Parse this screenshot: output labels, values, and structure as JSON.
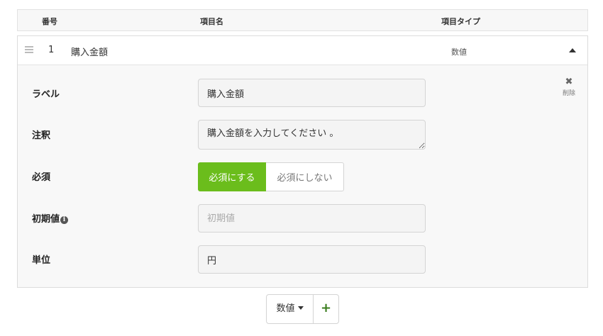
{
  "table_header": {
    "number": "番号",
    "name": "項目名",
    "type": "項目タイプ"
  },
  "item": {
    "number": "1",
    "name": "購入金額",
    "type": "数値"
  },
  "fields": {
    "label": {
      "title": "ラベル",
      "value": "購入金額"
    },
    "note": {
      "title": "注釈",
      "value": "購入金額を入力してください 。"
    },
    "required": {
      "title": "必須",
      "on_label": "必須にする",
      "off_label": "必須にしない"
    },
    "initial_value": {
      "title": "初期値",
      "placeholder": "初期値",
      "value": ""
    },
    "unit": {
      "title": "単位",
      "value": "円"
    }
  },
  "delete_label": "削除",
  "add_control": {
    "type_label": "数値",
    "add_label": "+"
  },
  "icons": {
    "drag": "drag-handle-icon",
    "collapse": "caret-up-icon",
    "delete": "close-icon",
    "info": "info-icon",
    "dropdown": "caret-down-icon",
    "add": "plus-icon"
  },
  "colors": {
    "accent_green": "#6bbd1c",
    "plus_green": "#3a7d1d"
  }
}
